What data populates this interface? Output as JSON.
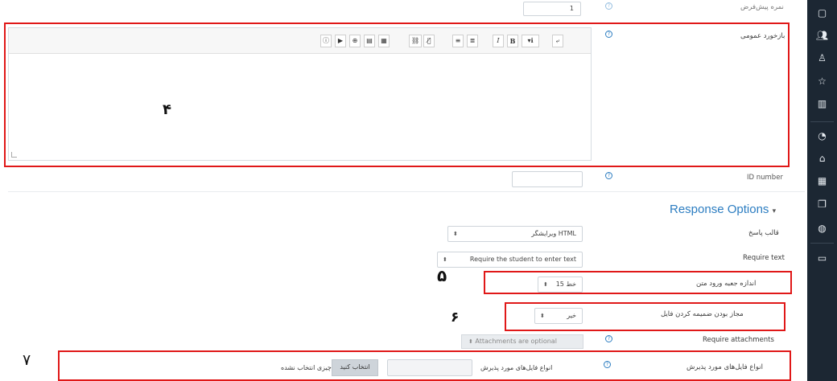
{
  "sidebar": {
    "icons": [
      "folder-icon",
      "users-icon",
      "user-group-icon",
      "star-icon",
      "book-icon",
      "dashboard-icon",
      "home-icon",
      "calendar-icon",
      "files-icon",
      "globe-icon",
      "folder-icon"
    ]
  },
  "top_row": {
    "label": "نمره پیش‌فرض",
    "value": "1"
  },
  "feedback": {
    "label": "بازخورد عمومی",
    "toolbar": [
      "ⓘ",
      "▶",
      "⊕",
      "▤",
      "▦",
      "⛓",
      "⛓̸",
      "≡",
      "≣",
      "I",
      "B",
      "▾ℹ",
      "⤶"
    ],
    "annotation": "۴"
  },
  "id_number": {
    "label": "ID number",
    "value": ""
  },
  "response_options": {
    "title": "Response Options",
    "response_format": {
      "label": "قالب پاسخ",
      "value": "ویرایشگر HTML"
    },
    "require_text": {
      "label": "Require text",
      "value": "Require the student to enter text"
    },
    "input_box_size": {
      "label": "اندازه جعبه ورود متن",
      "value": "15 خط",
      "annotation": "۵"
    },
    "allow_attachments": {
      "label": "مجاز بودن ضمیمه کردن فایل",
      "value": "خیر",
      "annotation": "۶"
    },
    "require_attachments": {
      "label": "Require attachments",
      "value": "Attachments are optional"
    },
    "accepted_file_types": {
      "label": "انواع فایل‌های مورد پذیرش",
      "inner_label": "انواع فایل‌های مورد پذیرش",
      "choose_button": "انتخاب کنید",
      "nothing_selected": "چیزی انتخاب نشده",
      "annotation": "۷"
    }
  },
  "colors": {
    "annotation_red": "#e01818",
    "link_blue": "#2c7dc1",
    "sidebar_bg": "#1c2733"
  }
}
